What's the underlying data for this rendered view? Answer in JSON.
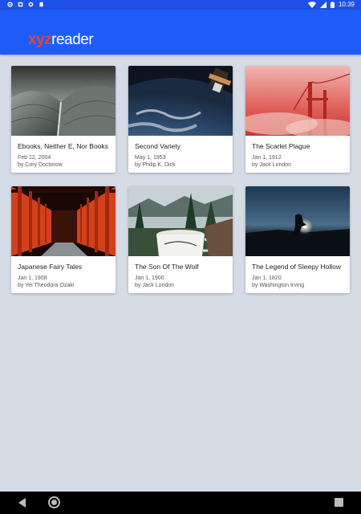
{
  "status_bar": {
    "time": "10:39"
  },
  "app": {
    "logo_accent": "xyz",
    "logo_rest": "reader",
    "bar_color": "#1f5cfa",
    "accent_color": "#e8452a"
  },
  "books": [
    {
      "title": "Ebooks, Neither E, Nor Books",
      "date": "Feb 12, 2004",
      "author": "by Cory Doctorow",
      "cover": "gray-architecture"
    },
    {
      "title": "Second Variety",
      "date": "May 1, 1953",
      "author": "by Philip K. Dick",
      "cover": "earth-from-orbit"
    },
    {
      "title": "The Scarlet Plague",
      "date": "Jan 1, 1912",
      "author": "by Jack London",
      "cover": "red-fog-bridge"
    },
    {
      "title": "Japanese Fairy Tales",
      "date": "Jan 1, 1908",
      "author": "by Yei Theodora Ozaki",
      "cover": "torii-gates"
    },
    {
      "title": "The Son Of The Wolf",
      "date": "Jan 1, 1900",
      "author": "by Jack London",
      "cover": "mug-lake-forest"
    },
    {
      "title": "The Legend of Sleepy Hollow",
      "date": "Jan 1, 1820",
      "author": "by Washington Irving",
      "cover": "lantern-night"
    }
  ]
}
